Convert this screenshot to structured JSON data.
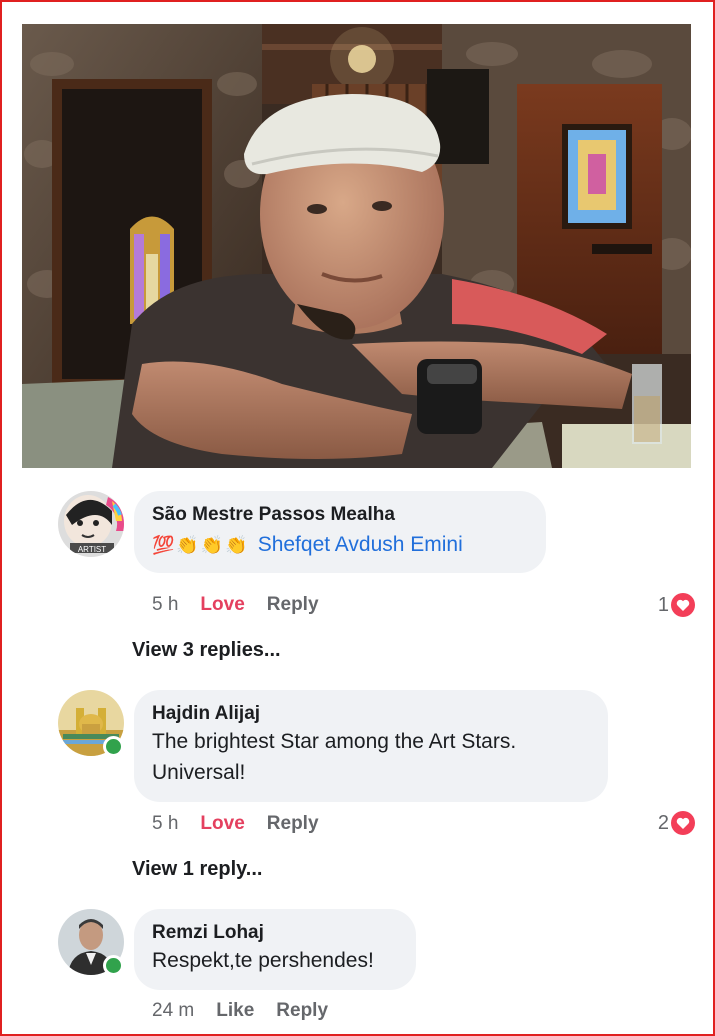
{
  "colors": {
    "frame": "#e02020",
    "love": "#e4405f",
    "mention": "#216fdb",
    "online": "#31a24c",
    "heart": "#f33e58"
  },
  "comments": [
    {
      "author": "São Mestre Passos Mealha",
      "emojis": [
        "💯",
        "👏",
        "👏",
        "👏"
      ],
      "mention": "Shefqet Avdush Emini",
      "time": "5 h",
      "reaction_label": "Love",
      "reply_label": "Reply",
      "reaction_count": "1",
      "avatar_icon": "avatar-girl-rainbow-icon",
      "avatar_text": "ARTIST"
    },
    {
      "author": "Hajdin Alijaj",
      "text_line1": "The brightest Star among the Art Stars.",
      "text_line2": "Universal!",
      "time": "5 h",
      "reaction_label": "Love",
      "reply_label": "Reply",
      "reaction_count": "2",
      "avatar_icon": "avatar-mosque-icon"
    },
    {
      "author": "Remzi Lohaj",
      "text_line1": "Respekt,te pershendes!",
      "time": "24 m",
      "reaction_label": "Like",
      "reply_label": "Reply",
      "avatar_icon": "avatar-man-icon"
    }
  ],
  "view_replies": [
    "View 3 replies...",
    "View 1 reply..."
  ],
  "icons": {
    "heart": "heart-icon",
    "online": "online-status-icon"
  }
}
